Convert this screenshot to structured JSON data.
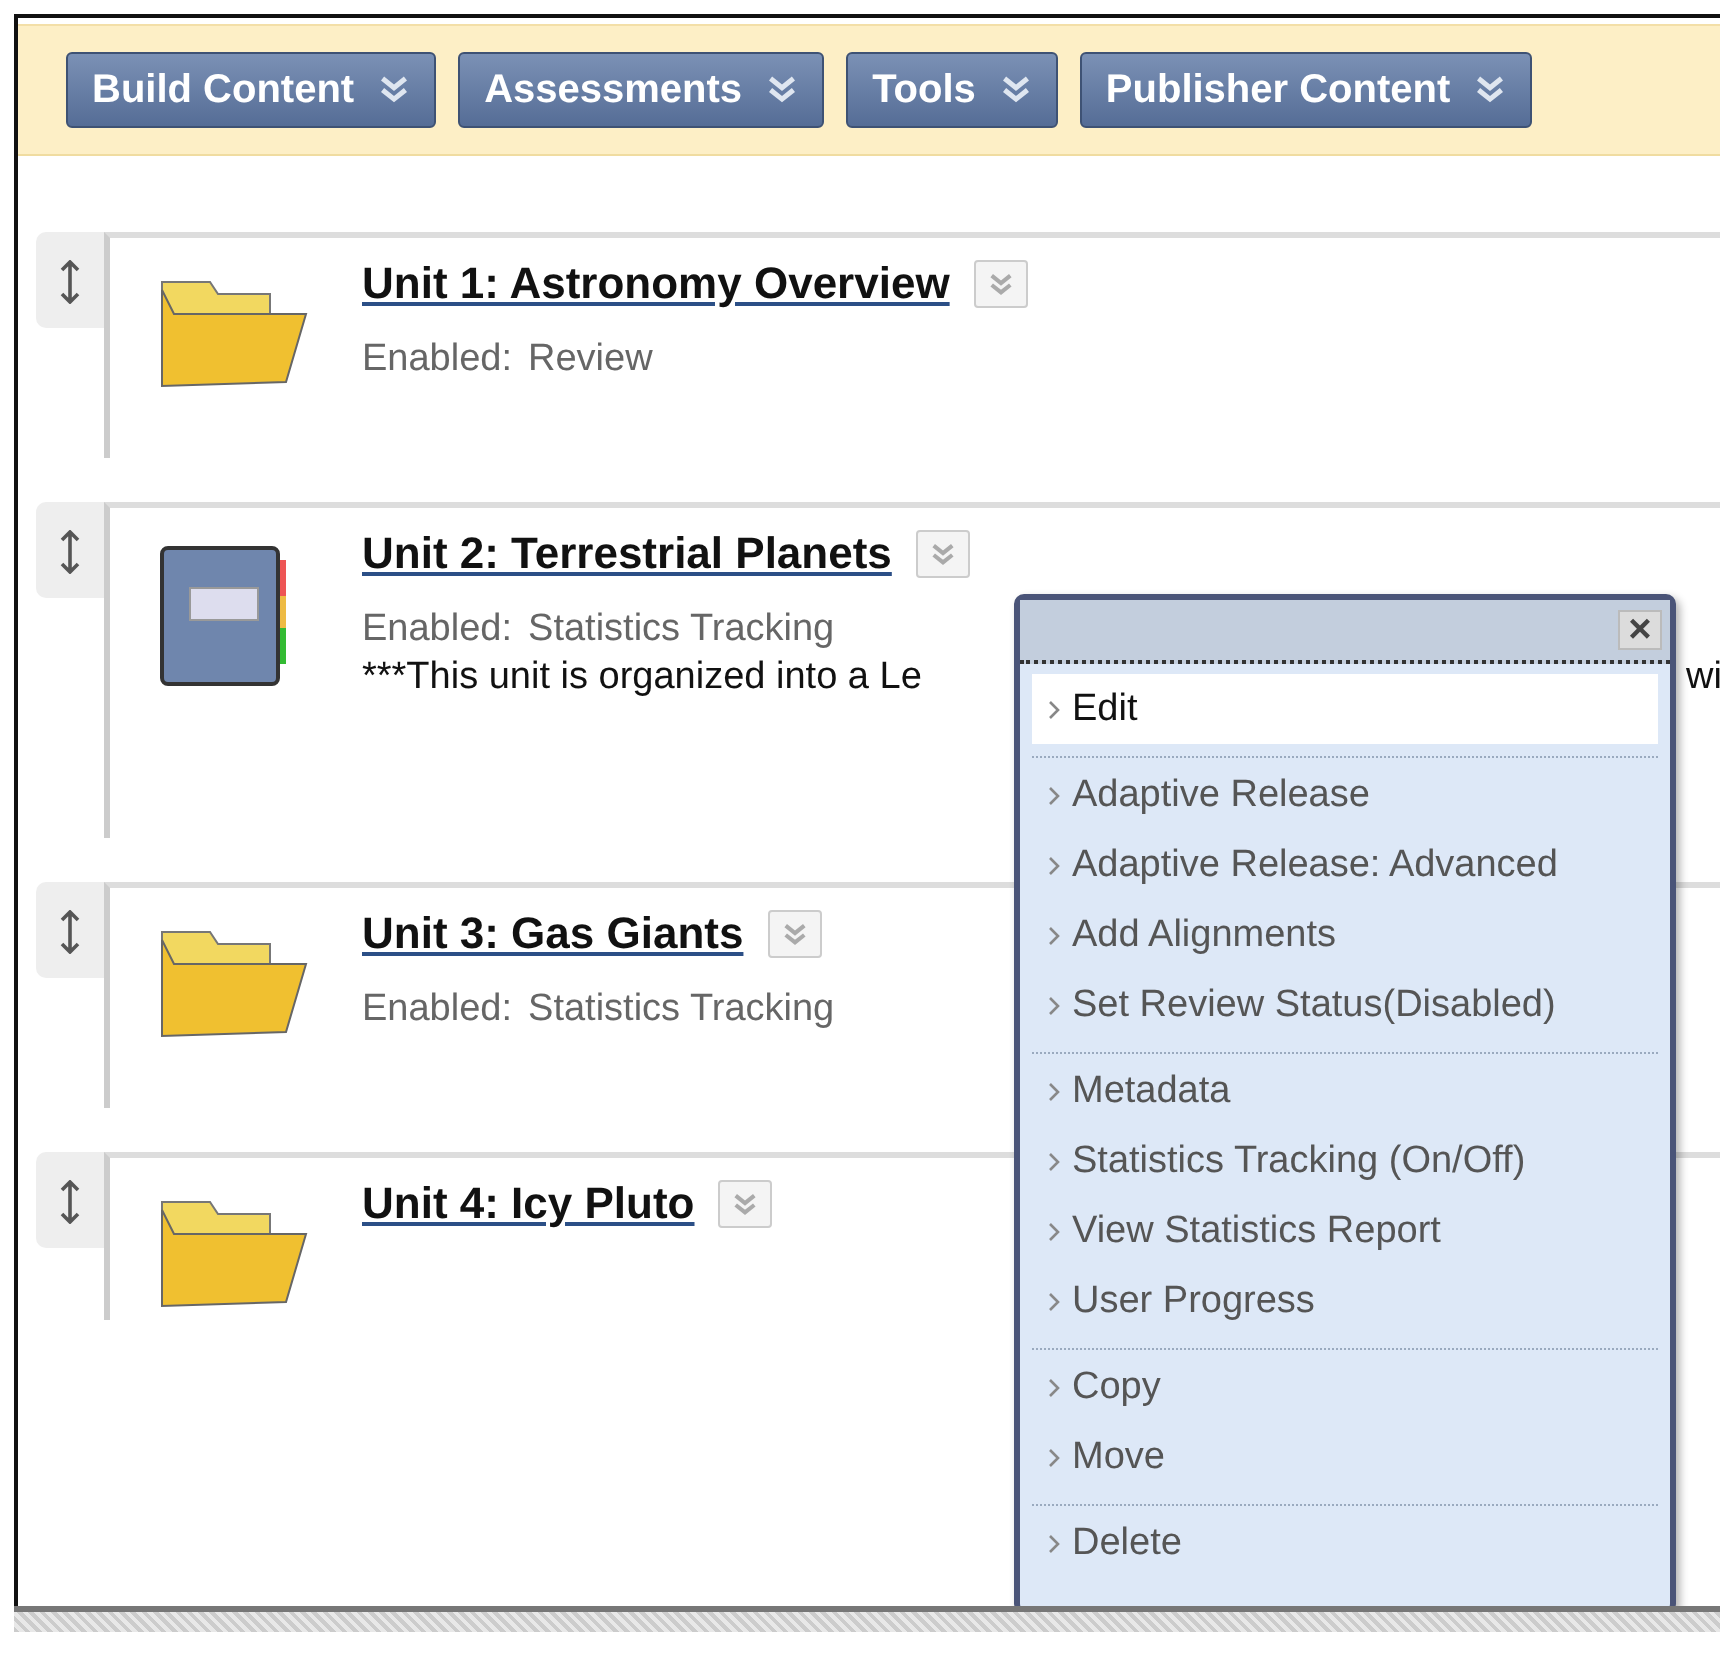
{
  "toolbar": {
    "buttons": [
      {
        "label": "Build Content"
      },
      {
        "label": "Assessments"
      },
      {
        "label": "Tools"
      },
      {
        "label": "Publisher Content"
      }
    ]
  },
  "items": [
    {
      "kind": "folder",
      "title": "Unit 1: Astronomy Overview",
      "enabled_label": "Enabled:",
      "enabled_value": "Review"
    },
    {
      "kind": "notebook",
      "title": "Unit 2: Terrestrial Planets",
      "enabled_label": "Enabled:",
      "enabled_value": "Statistics Tracking",
      "description": "***This unit is organized into a Le",
      "description_tail": "wi"
    },
    {
      "kind": "folder",
      "title": "Unit 3: Gas Giants",
      "enabled_label": "Enabled:",
      "enabled_value": "Statistics Tracking"
    },
    {
      "kind": "folder",
      "title": "Unit 4: Icy Pluto"
    }
  ],
  "context_menu": {
    "close_label": "×",
    "groups": [
      {
        "items": [
          {
            "label": "Edit",
            "selected": true
          }
        ]
      },
      {
        "items": [
          {
            "label": "Adaptive Release",
            "selected": false
          },
          {
            "label": "Adaptive Release: Advanced",
            "selected": false
          },
          {
            "label": "Add Alignments",
            "selected": false
          },
          {
            "label": "Set Review Status(Disabled)",
            "selected": false
          }
        ]
      },
      {
        "items": [
          {
            "label": "Metadata",
            "selected": false
          },
          {
            "label": "Statistics Tracking (On/Off)",
            "selected": false
          },
          {
            "label": "View Statistics Report",
            "selected": false
          },
          {
            "label": "User Progress",
            "selected": false
          }
        ]
      },
      {
        "items": [
          {
            "label": "Copy",
            "selected": false
          },
          {
            "label": "Move",
            "selected": false
          }
        ]
      },
      {
        "items": [
          {
            "label": "Delete",
            "selected": false
          }
        ]
      }
    ]
  }
}
